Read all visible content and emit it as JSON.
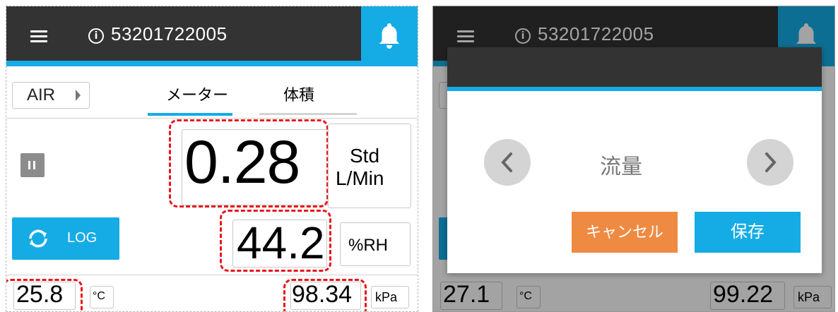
{
  "left": {
    "serial": "53201722005",
    "info_icon_glyph": "i",
    "air_label": "AIR",
    "tabs": [
      {
        "label": "メーター",
        "active": true
      },
      {
        "label": "体積",
        "active": false
      }
    ],
    "flow": {
      "value": "0.28",
      "unit_line1": "Std",
      "unit_line2": "L/Min"
    },
    "humidity": {
      "value": "44.2",
      "unit": "%RH"
    },
    "log_label": "LOG",
    "temperature": {
      "value": "25.8",
      "unit": "°C"
    },
    "pressure": {
      "value": "98.34",
      "unit": "kPa"
    }
  },
  "right": {
    "serial": "53201722005",
    "info_icon_glyph": "i",
    "dialog": {
      "title": "流量",
      "cancel_label": "キャンセル",
      "save_label": "保存"
    },
    "temperature": {
      "value": "27.1",
      "unit": "°C"
    },
    "pressure": {
      "value": "99.22",
      "unit": "kPa"
    }
  },
  "colors": {
    "header": "#333333",
    "accent": "#15ace6",
    "cancel": "#ef8a43",
    "highlight": "#e8141b"
  },
  "icons": [
    "menu-icon",
    "info-icon",
    "bell-icon",
    "pause-icon",
    "refresh-icon",
    "chevron-left-icon",
    "chevron-right-icon",
    "triangle-right-icon"
  ]
}
